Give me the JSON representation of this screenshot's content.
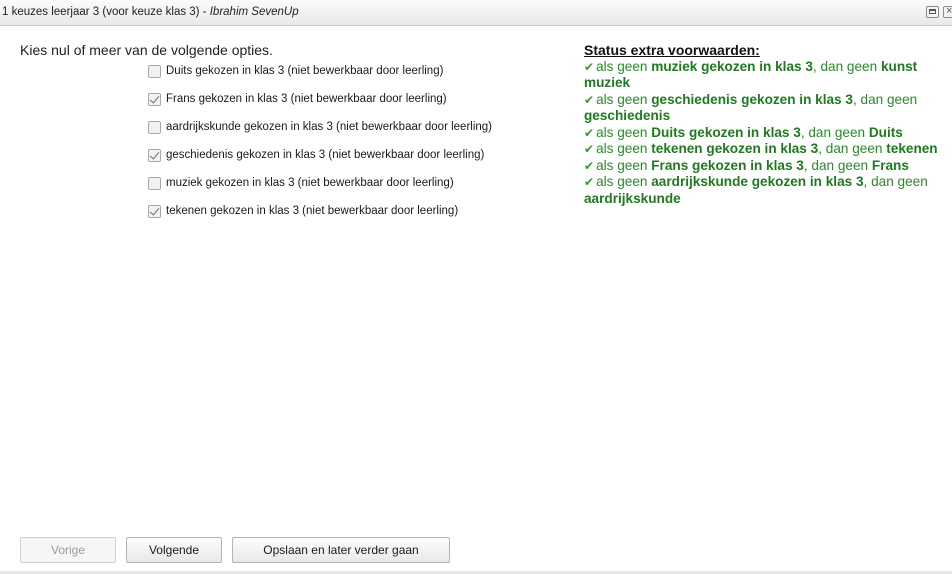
{
  "window": {
    "title": "1 keuzes leerjaar 3 (voor keuze klas 3) - ",
    "user": "Ibrahim SevenUp"
  },
  "prompt": "Kies nul of meer van de volgende opties.",
  "options": [
    {
      "label": "Duits gekozen in klas 3 (niet bewerkbaar door leerling)",
      "checked": false
    },
    {
      "label": "Frans gekozen in klas 3 (niet bewerkbaar door leerling)",
      "checked": true
    },
    {
      "label": "aardrijkskunde gekozen in klas 3 (niet bewerkbaar door leerling)",
      "checked": false
    },
    {
      "label": "geschiedenis gekozen in klas 3 (niet bewerkbaar door leerling)",
      "checked": true
    },
    {
      "label": "muziek gekozen in klas 3 (niet bewerkbaar door leerling)",
      "checked": false
    },
    {
      "label": "tekenen gekozen in klas 3 (niet bewerkbaar door leerling)",
      "checked": true
    }
  ],
  "status": {
    "heading": "Status extra voorwaarden:",
    "conditions": [
      {
        "a": "als geen ",
        "b": "muziek gekozen in klas 3",
        "c": ", dan geen ",
        "d": "kunst muziek"
      },
      {
        "a": "als geen ",
        "b": "geschiedenis gekozen in klas 3",
        "c": ", dan geen ",
        "d": "geschiedenis"
      },
      {
        "a": "als geen ",
        "b": "Duits gekozen in klas 3",
        "c": ", dan geen ",
        "d": "Duits"
      },
      {
        "a": "als geen ",
        "b": "tekenen gekozen in klas 3",
        "c": ", dan geen ",
        "d": "tekenen"
      },
      {
        "a": "als geen ",
        "b": "Frans gekozen in klas 3",
        "c": ", dan geen ",
        "d": "Frans"
      },
      {
        "a": "als geen ",
        "b": "aardrijkskunde gekozen in klas 3",
        "c": ", dan geen ",
        "d": "aardrijkskunde"
      }
    ]
  },
  "buttons": {
    "prev": "Vorige",
    "next": "Volgende",
    "save": "Opslaan en later verder gaan"
  },
  "colors": {
    "status_ok": "#2a8a2a",
    "checkbox_border": "#a9a9a9"
  }
}
